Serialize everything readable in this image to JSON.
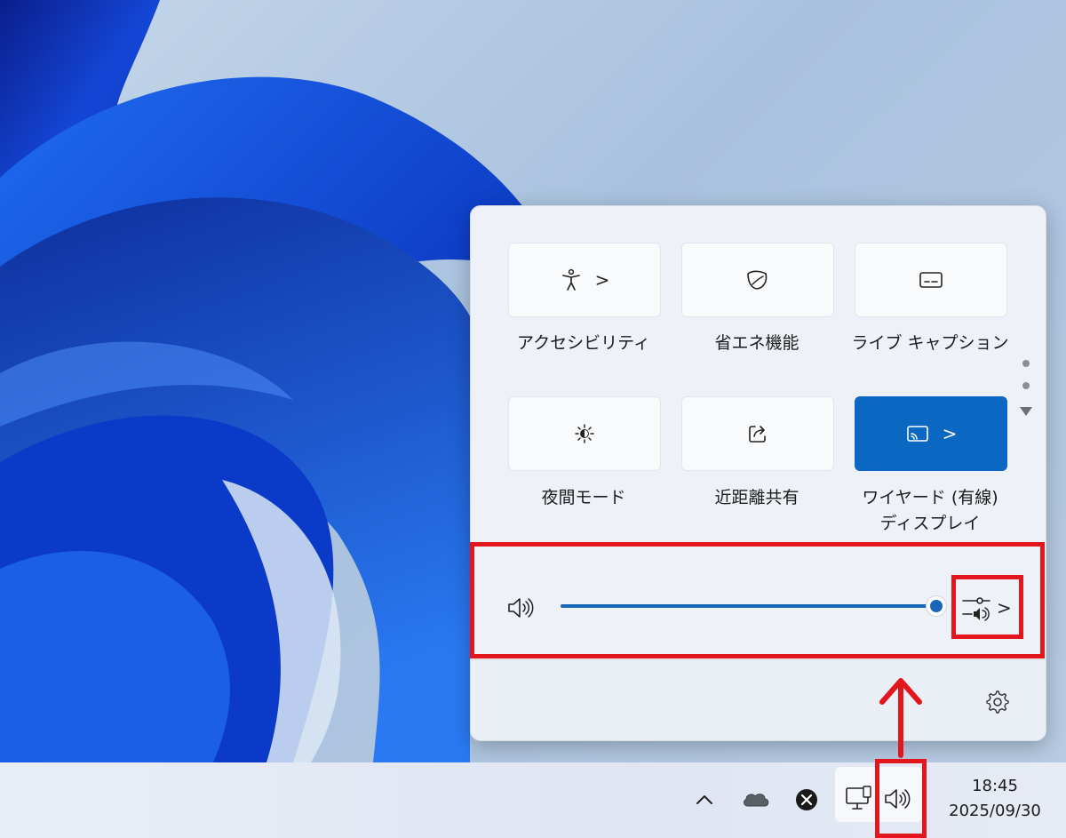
{
  "quick_settings": {
    "tiles": [
      {
        "label": "アクセシビリティ",
        "icon": "accessibility-icon",
        "has_chevron": true,
        "active": false
      },
      {
        "label": "省エネ機能",
        "icon": "energy-saver-leaf-icon",
        "has_chevron": false,
        "active": false
      },
      {
        "label": "ライブ キャプション",
        "icon": "live-captions-icon",
        "has_chevron": false,
        "active": false
      },
      {
        "label": "夜間モード",
        "icon": "night-light-icon",
        "has_chevron": false,
        "active": false
      },
      {
        "label": "近距離共有",
        "icon": "nearby-share-icon",
        "has_chevron": false,
        "active": false
      },
      {
        "label": "ワイヤード (有線)",
        "label_line2": "ディスプレイ",
        "icon": "cast-display-icon",
        "has_chevron": true,
        "active": true
      }
    ],
    "tile_chevron": ">",
    "volume": {
      "icon": "speaker-icon",
      "level_percent": 100,
      "mixer_icon": "sound-mixer-icon",
      "mixer_chevron": ">"
    },
    "settings_icon": "gear-icon"
  },
  "taskbar": {
    "tray_icons": [
      "chevron-up-icon",
      "onedrive-cloud-icon",
      "error-x-icon",
      "network-desktop-icon",
      "speaker-icon"
    ],
    "clock": {
      "time": "18:45",
      "date": "2025/09/30"
    }
  },
  "colors": {
    "accent": "#0a67c2",
    "annotation_red": "#e3161d"
  }
}
